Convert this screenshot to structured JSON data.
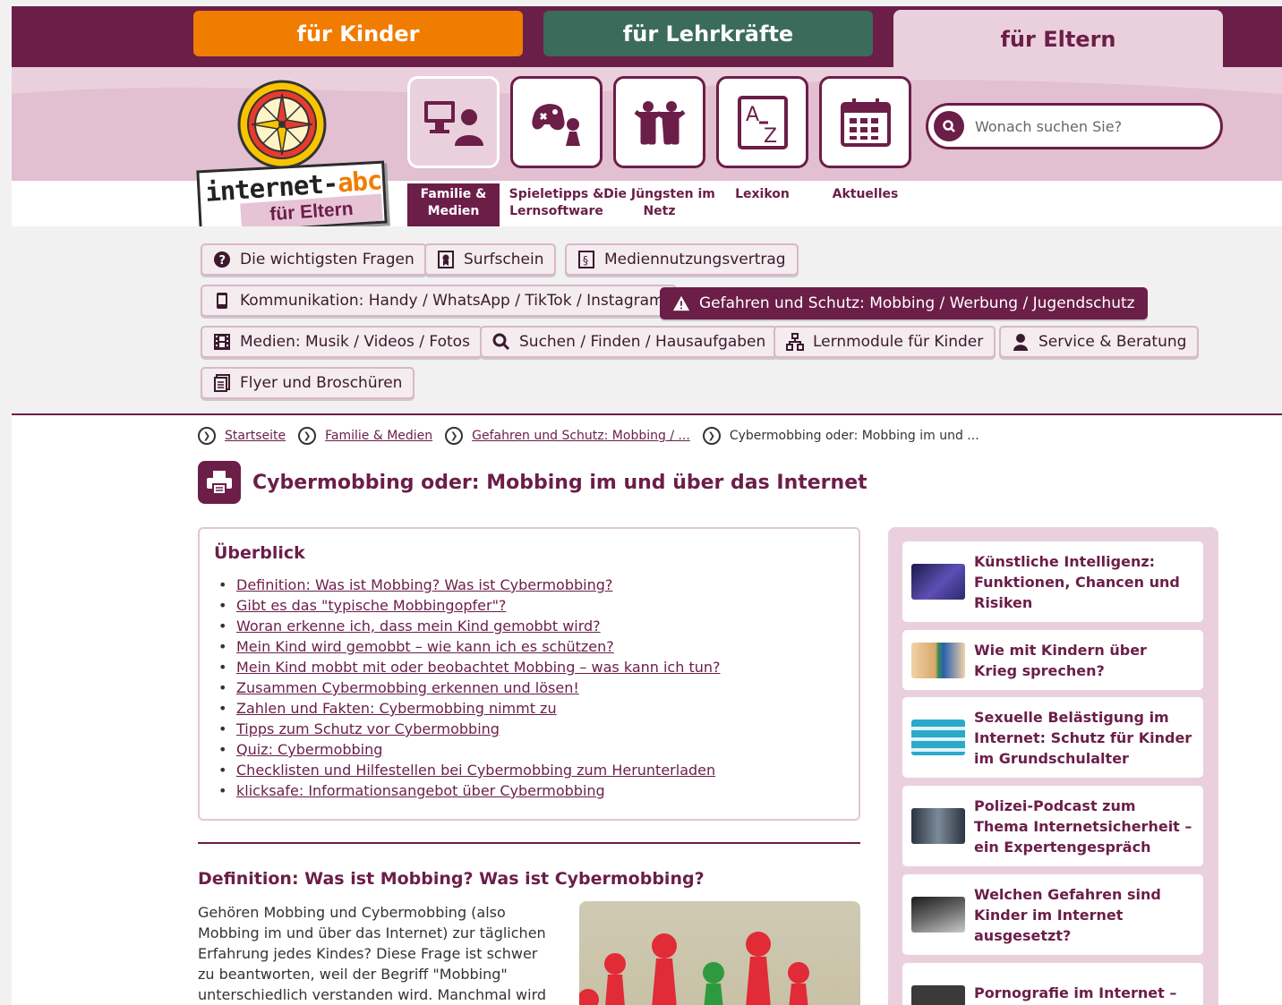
{
  "audience_tabs": {
    "kinder": "für Kinder",
    "lehrkraefte": "für Lehrkräfte",
    "eltern": "für Eltern"
  },
  "logo": {
    "line1_a": "internet-",
    "line1_b": "abc",
    "line2": "für Eltern"
  },
  "main_nav": [
    {
      "label": "Familie & Medien",
      "icon": "computer-user-icon",
      "active": true
    },
    {
      "label": "Spieletipps & Lernsoftware",
      "icon": "gamepad-icon",
      "active": false
    },
    {
      "label": "Die Jüngsten im Netz",
      "icon": "children-icon",
      "active": false
    },
    {
      "label": "Lexikon",
      "icon": "a-z-icon",
      "active": false
    },
    {
      "label": "Aktuelles",
      "icon": "calendar-icon",
      "active": false
    }
  ],
  "search": {
    "placeholder": "Wonach suchen Sie?"
  },
  "subnav": {
    "fragen": "Die wichtigsten Fragen",
    "surfschein": "Surfschein",
    "vertrag": "Mediennutzungsvertrag",
    "kommunikation": "Kommunikation: Handy / WhatsApp / TikTok / Instagram",
    "gefahren": "Gefahren und Schutz: Mobbing / Werbung / Jugendschutz",
    "medien": "Medien: Musik / Videos / Fotos",
    "suchen": "Suchen / Finden / Hausaufgaben",
    "lernmodule": "Lernmodule für Kinder",
    "service": "Service & Beratung",
    "flyer": "Flyer und Broschüren"
  },
  "breadcrumb": [
    "Startseite",
    "Familie & Medien",
    "Gefahren und Schutz: Mobbing / ...",
    "Cybermobbing oder: Mobbing im und ..."
  ],
  "page_title": "Cybermobbing oder: Mobbing im und über das Internet",
  "overview": {
    "heading": "Überblick",
    "items": [
      "Definition: Was ist Mobbing? Was ist Cybermobbing?",
      "Gibt es das \"typische Mobbingopfer\"?",
      "Woran erkenne ich, dass mein Kind gemobbt wird?",
      "Mein Kind wird gemobbt – wie kann ich es schützen?",
      "Mein Kind mobbt mit oder beobachtet Mobbing – was kann ich tun?",
      "Zusammen Cybermobbing erkennen und lösen!",
      "Zahlen und Fakten: Cybermobbing nimmt zu",
      "Tipps zum Schutz vor Cybermobbing",
      "Quiz: Cybermobbing",
      "Checklisten und Hilfestellen bei Cybermobbing zum Herunterladen",
      "klicksafe: Informationsangebot über Cybermobbing"
    ]
  },
  "section": {
    "title": "Definition: Was ist Mobbing? Was ist Cybermobbing?",
    "text": "Gehören Mobbing und Cybermobbing (also Mobbing im und über das Internet) zur täglichen Erfahrung jedes Kindes? Diese Frage ist schwer zu beantworten, weil der Begriff \"Mobbing\" unterschiedlich verstanden wird. Manchmal wird"
  },
  "sidebar": [
    "Künstliche Intelligenz: Funktionen, Chancen und Risiken",
    "Wie mit Kindern über Krieg sprechen?",
    "Sexuelle Belästigung im Internet: Schutz für Kinder im Grundschulalter",
    "Polizei-Podcast zum Thema Internetsicherheit – ein Expertengespräch",
    "Welchen Gefahren sind Kinder im Internet ausgesetzt?",
    "Pornografie im Internet – wie schütze ich mein Kind"
  ],
  "colors": {
    "brand": "#6b1e48",
    "orange": "#f07c00",
    "green": "#3b6b5b",
    "pink": "#ead0dd"
  }
}
